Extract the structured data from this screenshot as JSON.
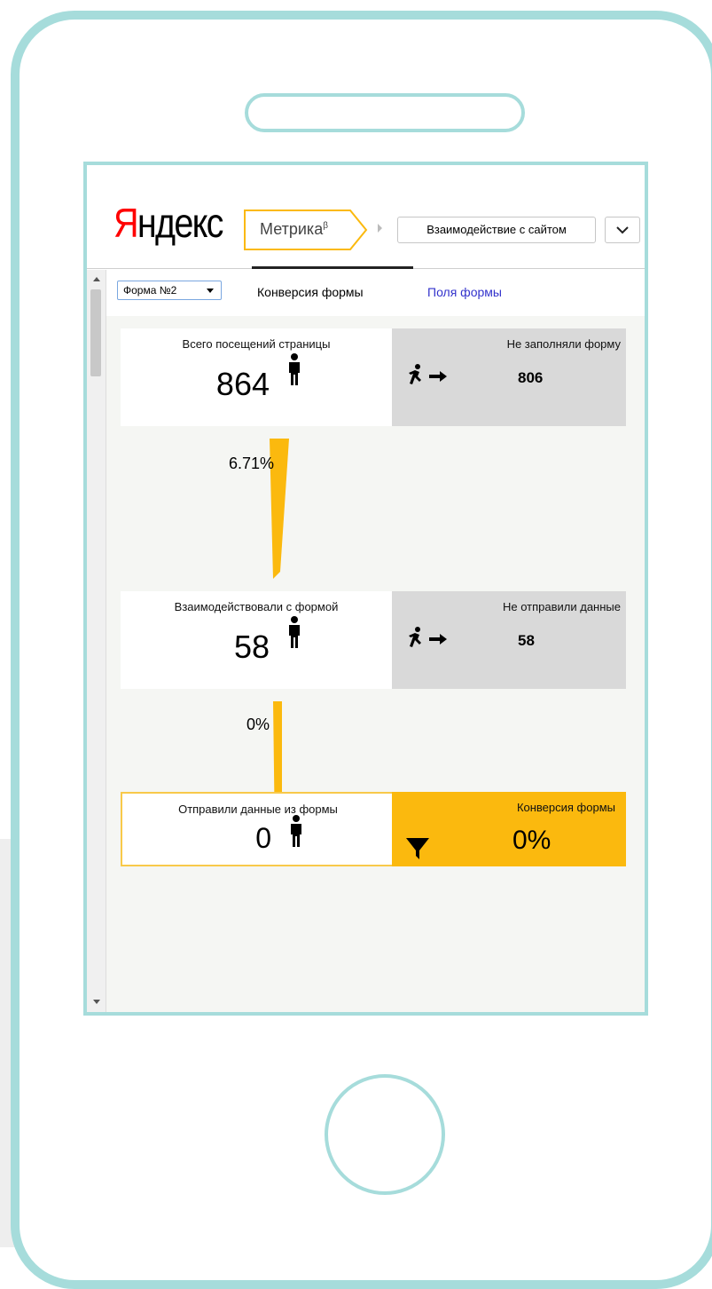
{
  "app": {
    "logo_first": "Я",
    "logo_rest": "ндекс",
    "product": "Метрика",
    "product_superscript": "β",
    "report_select": "Взаимодействие с сайтом"
  },
  "toolbar": {
    "form_select": "Форма №2",
    "tabs": [
      {
        "label": "Конверсия формы",
        "active": true
      },
      {
        "label": "Поля формы",
        "active": false
      }
    ]
  },
  "funnel": {
    "stages": [
      {
        "label": "Всего посещений страницы",
        "count": "864",
        "drop_label": "Не заполняли форму",
        "drop_count": "806"
      },
      {
        "label": "Взаимодействовали с формой",
        "count": "58",
        "drop_label": "Не отправили данные",
        "drop_count": "58"
      },
      {
        "label": "Отправили данные из формы",
        "count": "0",
        "conversion_label": "Конверсия формы",
        "conversion_value": "0%"
      }
    ],
    "transitions": [
      {
        "percent": "6.71%",
        "rate": 0.0671
      },
      {
        "percent": "0%",
        "rate": 0
      }
    ]
  },
  "colors": {
    "phone_frame": "#a6dcdb",
    "accent_yellow": "#fbb90e",
    "drop_grey": "#d9d9d9",
    "logo_red": "#ff0000",
    "link_blue": "#3333cc"
  },
  "icons": [
    "person-icon",
    "runner-icon",
    "arrow-right-icon",
    "funnel-icon",
    "chevron-down-icon"
  ]
}
